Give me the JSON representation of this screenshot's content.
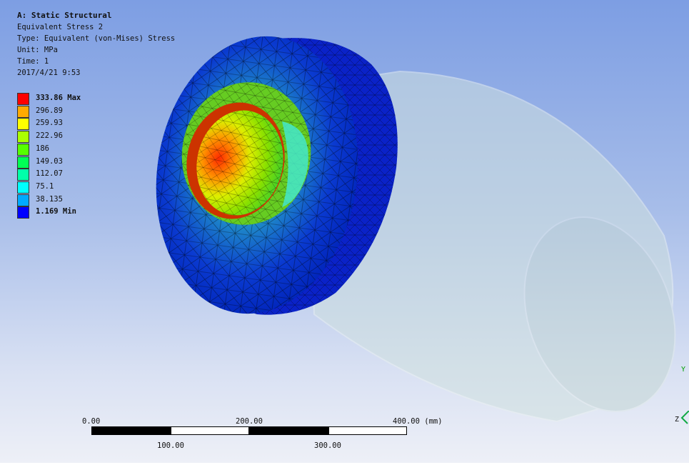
{
  "header": {
    "title": "A: Static Structural",
    "result_name": "Equivalent Stress 2",
    "type_line": "Type: Equivalent (von-Mises) Stress",
    "unit_line": "Unit: MPa",
    "time_line": "Time: 1",
    "timestamp": "2017/4/21 9:53"
  },
  "legend": {
    "entries": [
      {
        "label": "333.86 Max",
        "color": "#ff0000",
        "bold": true
      },
      {
        "label": "296.89",
        "color": "#ffaa00",
        "bold": false
      },
      {
        "label": "259.93",
        "color": "#ffff00",
        "bold": false
      },
      {
        "label": "222.96",
        "color": "#aaff00",
        "bold": false
      },
      {
        "label": "186",
        "color": "#55ff00",
        "bold": false
      },
      {
        "label": "149.03",
        "color": "#00ff55",
        "bold": false
      },
      {
        "label": "112.07",
        "color": "#00ffaa",
        "bold": false
      },
      {
        "label": "75.1",
        "color": "#00ffff",
        "bold": false
      },
      {
        "label": "38.135",
        "color": "#00aaff",
        "bold": false
      },
      {
        "label": "1.169 Min",
        "color": "#0000ff",
        "bold": true
      }
    ]
  },
  "scale_bar": {
    "top_labels": [
      "0.00",
      "200.00",
      "400.00 (mm)"
    ],
    "bottom_labels": [
      "100.00",
      "300.00"
    ]
  },
  "triad": {
    "y_label": "Y",
    "z_label": "Z",
    "y_color": "#00a000"
  },
  "colors": {
    "mesh_line": "#000000",
    "ghost_body": "#cfe0df"
  }
}
